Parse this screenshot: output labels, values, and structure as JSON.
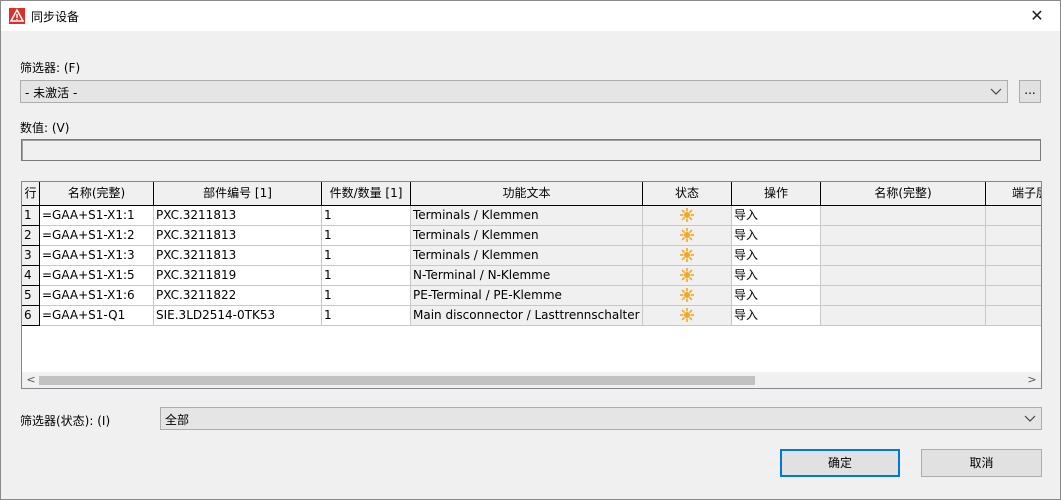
{
  "window": {
    "title": "同步设备"
  },
  "filter": {
    "label": "筛选器: (F)",
    "value": "- 未激活 -",
    "more_button": "..."
  },
  "value_field": {
    "label": "数值: (V)",
    "value": ""
  },
  "table": {
    "columns": [
      "行",
      "名称(完整)",
      "部件编号 [1]",
      "件数/数量 [1]",
      "功能文本",
      "状态",
      "操作",
      "名称(完整)",
      "端子层"
    ],
    "rows": [
      {
        "row": "1",
        "name": "=GAA+S1-X1:1",
        "part": "PXC.3211813",
        "qty": "1",
        "func": "Terminals / Klemmen",
        "action": "导入"
      },
      {
        "row": "2",
        "name": "=GAA+S1-X1:2",
        "part": "PXC.3211813",
        "qty": "1",
        "func": "Terminals / Klemmen",
        "action": "导入"
      },
      {
        "row": "3",
        "name": "=GAA+S1-X1:3",
        "part": "PXC.3211813",
        "qty": "1",
        "func": "Terminals / Klemmen",
        "action": "导入"
      },
      {
        "row": "4",
        "name": "=GAA+S1-X1:5",
        "part": "PXC.3211819",
        "qty": "1",
        "func": "N-Terminal / N-Klemme",
        "action": "导入"
      },
      {
        "row": "5",
        "name": "=GAA+S1-X1:6",
        "part": "PXC.3211822",
        "qty": "1",
        "func": "PE-Terminal / PE-Klemme",
        "action": "导入"
      },
      {
        "row": "6",
        "name": "=GAA+S1-Q1",
        "part": "SIE.3LD2514-0TK53",
        "qty": "1",
        "func": "Main disconnector / Lasttrennschalter",
        "action": "导入"
      }
    ]
  },
  "status_filter": {
    "label": "筛选器(状态): (I)",
    "value": "全部"
  },
  "buttons": {
    "ok": "确定",
    "cancel": "取消"
  },
  "colors": {
    "status_icon": "#f5a623",
    "accent": "#0078d7"
  }
}
